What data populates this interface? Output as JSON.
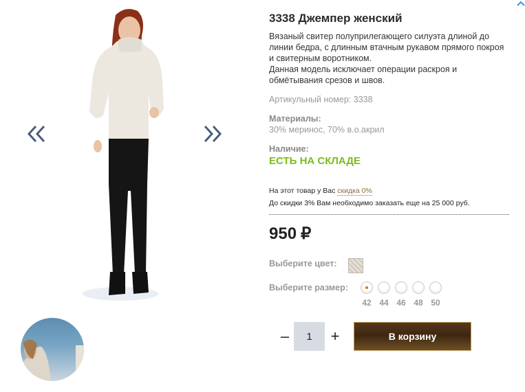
{
  "product": {
    "title": "3338 Джемпер женский",
    "description": [
      "Вязаный свитер полуприлегающего силуэта длиной до линии бедра, с длинным втачным рукавом прямого покроя и свитерным воротником.",
      "Данная модель исключает операции раскроя и обмётывания срезов и швов."
    ],
    "article": "Артикульный номер: 3338",
    "materials_label": "Материалы:",
    "materials_value": "30% меринос, 70% в.о.акрил",
    "availability_label": "Наличие:",
    "availability_value": "ЕСТЬ НА СКЛАДЕ"
  },
  "discount": {
    "line1_prefix": "На этот товар у Вас",
    "line1_link": "скидка 0%",
    "line2": "До скидки 3% Вам необходимо заказать еще на 25 000 руб."
  },
  "price": {
    "value": "950",
    "currency": "₽"
  },
  "options": {
    "color_label": "Выберите цвет:",
    "size_label": "Выберите размер:",
    "sizes": [
      "42",
      "44",
      "46",
      "48",
      "50"
    ],
    "selected_size": "42"
  },
  "cart": {
    "minus": "–",
    "plus": "+",
    "quantity": "1",
    "button_label": "В корзину"
  },
  "colors": {
    "availability": "#7cbb1b",
    "arrows": "#4a5d7a",
    "button": "#3e2710"
  },
  "icons": {
    "prev": "double-chevron-left-icon",
    "next": "double-chevron-right-icon",
    "scroll_up": "chevron-up-icon"
  }
}
